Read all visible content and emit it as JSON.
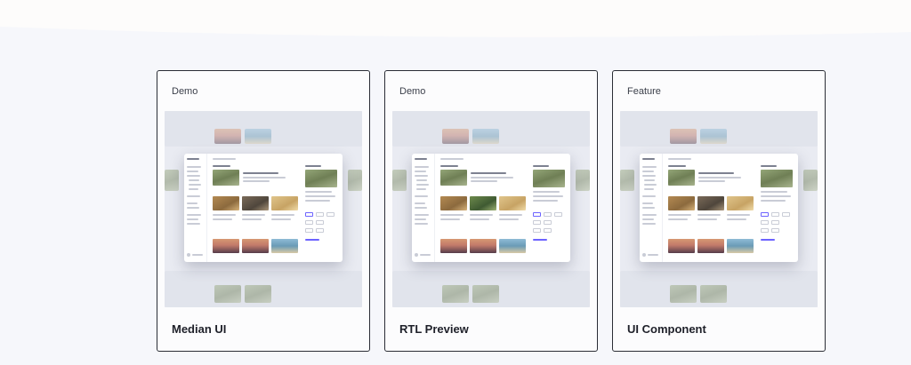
{
  "cards": [
    {
      "tag": "Demo",
      "title": "Median UI",
      "preview_icon": "median-ui-dashboard-screenshot"
    },
    {
      "tag": "Demo",
      "title": "RTL Preview",
      "preview_icon": "rtl-preview-dashboard-screenshot"
    },
    {
      "tag": "Feature",
      "title": "UI Component",
      "preview_icon": "ui-component-dashboard-screenshot"
    }
  ],
  "colors": {
    "page_background": "#f6f7fb",
    "card_background": "#fcfcfd",
    "card_border": "#2a2d35",
    "accent": "#6c63ff"
  }
}
